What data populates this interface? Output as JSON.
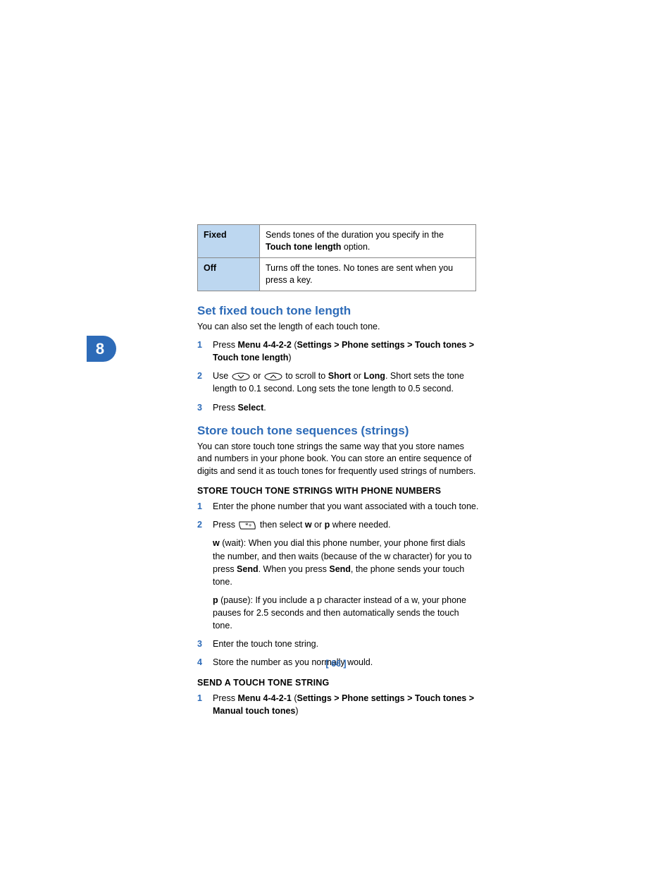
{
  "chapter_tab": "8",
  "table": {
    "rows": [
      {
        "label": "Fixed",
        "desc_pre": "Sends tones of the duration you specify in the ",
        "desc_bold": "Touch tone length",
        "desc_post": " option."
      },
      {
        "label": "Off",
        "desc_pre": "Turns off the tones. No tones are sent when you press a key.",
        "desc_bold": "",
        "desc_post": ""
      }
    ]
  },
  "section1": {
    "heading": "Set fixed touch tone length",
    "intro": "You can also set the length of each touch tone.",
    "steps": {
      "s1": {
        "num": "1",
        "pre": "Press ",
        "b1": "Menu 4-4-2-2",
        "mid": " (",
        "b2": "Settings > Phone settings > Touch tones > Touch tone length",
        "post": ")"
      },
      "s2": {
        "num": "2",
        "pre": "Use ",
        "mid": " or ",
        "post1": " to scroll to ",
        "b1": "Short",
        "or": " or ",
        "b2": "Long",
        "post2": ". Short sets the tone length to 0.1 second. Long sets the tone length to 0.5 second."
      },
      "s3": {
        "num": "3",
        "pre": "Press ",
        "b1": "Select",
        "post": "."
      }
    }
  },
  "section2": {
    "heading": "Store touch tone sequences (strings)",
    "intro": "You can store touch tone strings the same way that you store names and numbers in your phone book. You can store an entire sequence of digits and send it as touch tones for frequently used strings of numbers.",
    "sub1": {
      "heading": "STORE TOUCH TONE STRINGS WITH PHONE NUMBERS",
      "steps": {
        "s1": {
          "num": "1",
          "text": "Enter the phone number that you want associated with a touch tone."
        },
        "s2": {
          "num": "2",
          "pre": "Press ",
          "post1": " then select ",
          "b1": "w",
          "or": " or ",
          "b2": "p",
          "post2": " where needed.",
          "p2_b": "w",
          "p2_rest": " (wait): When you dial this phone number, your phone first dials the number, and then waits (because of the w character) for you to press ",
          "p2_b2": "Send",
          "p2_mid": ". When you press ",
          "p2_b3": "Send",
          "p2_end": ", the phone sends your touch tone.",
          "p3_b": "p",
          "p3_rest": " (pause): If you include a p character instead of a w, your phone pauses for 2.5 seconds and then automatically sends the touch tone."
        },
        "s3": {
          "num": "3",
          "text": "Enter the touch tone string."
        },
        "s4": {
          "num": "4",
          "text": "Store the number as you normally would."
        }
      }
    },
    "sub2": {
      "heading": "SEND A TOUCH TONE STRING",
      "steps": {
        "s1": {
          "num": "1",
          "pre": "Press ",
          "b1": "Menu 4-4-2-1",
          "mid": " (",
          "b2": "Settings > Phone settings > Touch tones > Manual touch tones",
          "post": ")"
        }
      }
    }
  },
  "footer": "[ 66 ]"
}
